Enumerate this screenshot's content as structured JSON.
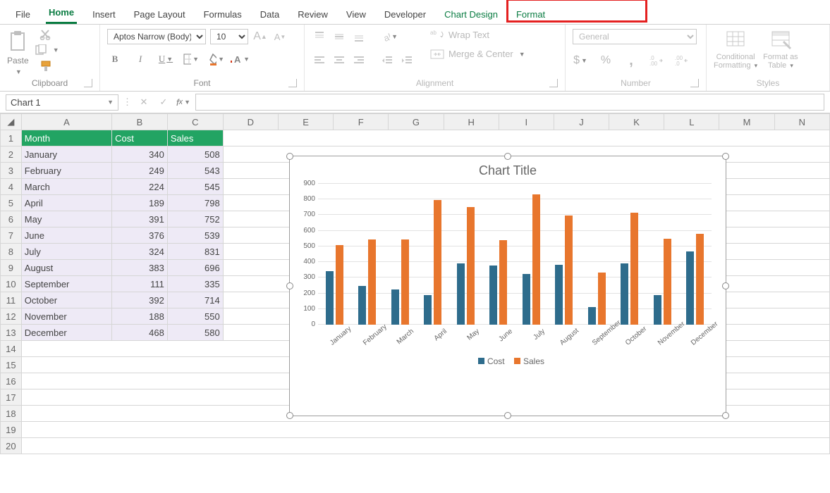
{
  "tabs": {
    "file": "File",
    "home": "Home",
    "insert": "Insert",
    "page_layout": "Page Layout",
    "formulas": "Formulas",
    "data": "Data",
    "review": "Review",
    "view": "View",
    "developer": "Developer",
    "chart_design": "Chart Design",
    "format": "Format"
  },
  "ribbon": {
    "clipboard": {
      "paste": "Paste",
      "label": "Clipboard"
    },
    "font": {
      "name": "Aptos Narrow (Body)",
      "size": "10",
      "bold": "B",
      "italic": "I",
      "label": "Font"
    },
    "alignment": {
      "wrap": "Wrap Text",
      "merge": "Merge & Center",
      "label": "Alignment"
    },
    "number": {
      "format": "General",
      "label": "Number"
    },
    "styles": {
      "cond": "Conditional Formatting",
      "fmt_table": "Format as Table",
      "label": "Styles"
    }
  },
  "namebox": {
    "value": "Chart 1"
  },
  "columns": [
    "A",
    "B",
    "C",
    "D",
    "E",
    "F",
    "G",
    "H",
    "I",
    "J",
    "K",
    "L",
    "M",
    "N"
  ],
  "headers": {
    "month": "Month",
    "cost": "Cost",
    "sales": "Sales"
  },
  "rows": [
    {
      "m": "January",
      "c": 340,
      "s": 508
    },
    {
      "m": "February",
      "c": 249,
      "s": 543
    },
    {
      "m": "March",
      "c": 224,
      "s": 545
    },
    {
      "m": "April",
      "c": 189,
      "s": 798
    },
    {
      "m": "May",
      "c": 391,
      "s": 752
    },
    {
      "m": "June",
      "c": 376,
      "s": 539
    },
    {
      "m": "July",
      "c": 324,
      "s": 831
    },
    {
      "m": "August",
      "c": 383,
      "s": 696
    },
    {
      "m": "September",
      "c": 111,
      "s": 335
    },
    {
      "m": "October",
      "c": 392,
      "s": 714
    },
    {
      "m": "November",
      "c": 188,
      "s": 550
    },
    {
      "m": "December",
      "c": 468,
      "s": 580
    }
  ],
  "chart": {
    "title": "Chart Title",
    "legend_cost": "Cost",
    "legend_sales": "Sales",
    "yticks": [
      0,
      100,
      200,
      300,
      400,
      500,
      600,
      700,
      800,
      900
    ]
  },
  "chart_data": {
    "type": "bar",
    "title": "Chart Title",
    "categories": [
      "January",
      "February",
      "March",
      "April",
      "May",
      "June",
      "July",
      "August",
      "September",
      "October",
      "November",
      "December"
    ],
    "series": [
      {
        "name": "Cost",
        "values": [
          340,
          249,
          224,
          189,
          391,
          376,
          324,
          383,
          111,
          392,
          188,
          468
        ]
      },
      {
        "name": "Sales",
        "values": [
          508,
          543,
          545,
          798,
          752,
          539,
          831,
          696,
          335,
          714,
          550,
          580
        ]
      }
    ],
    "xlabel": "",
    "ylabel": "",
    "ylim": [
      0,
      900
    ]
  }
}
